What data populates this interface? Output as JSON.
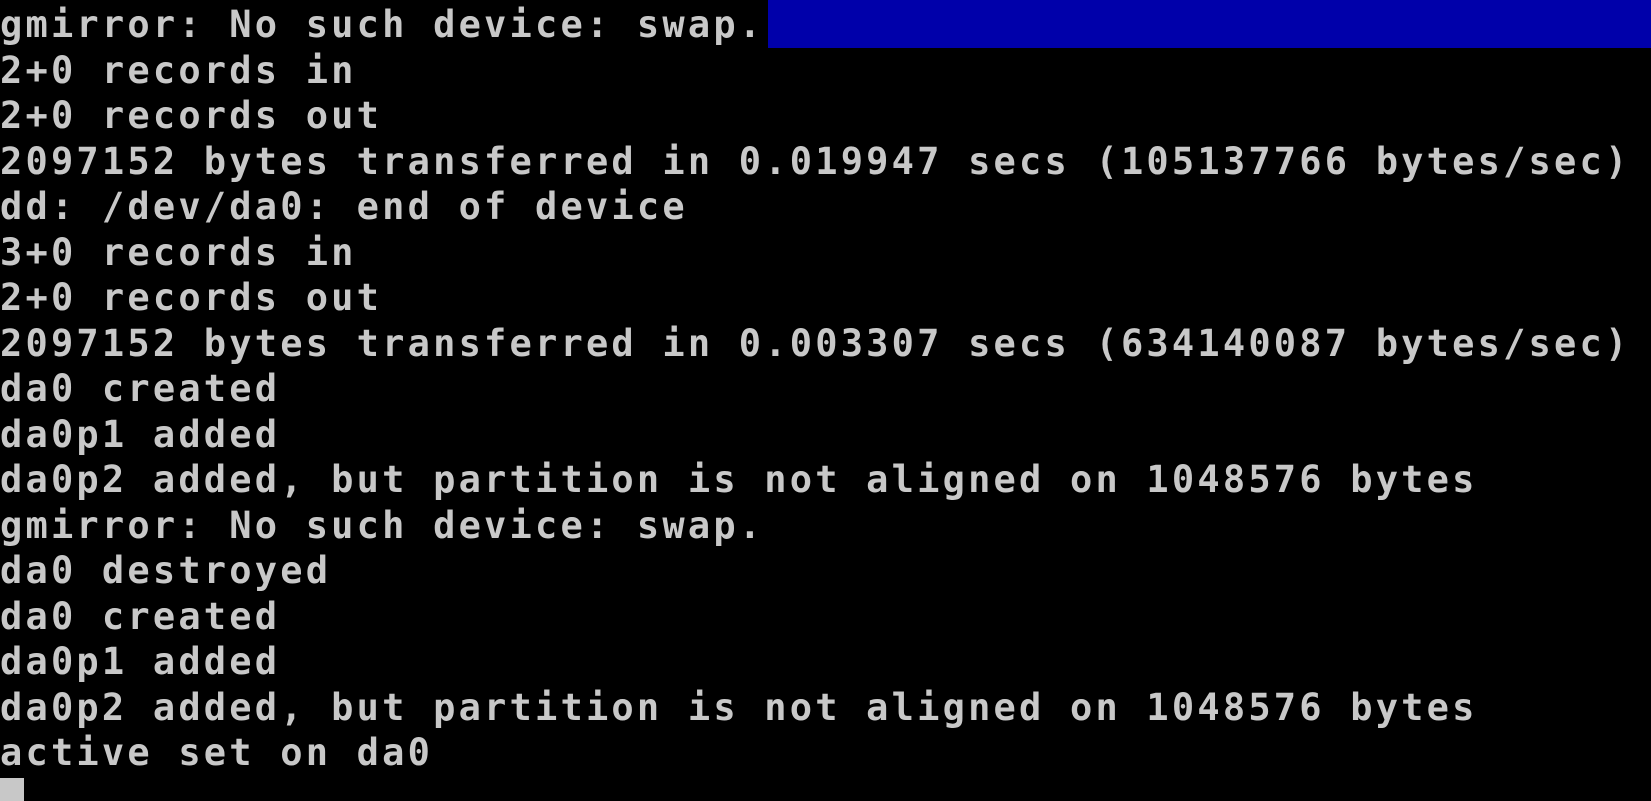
{
  "console": {
    "lines": [
      "gmirror: No such device: swap.",
      "2+0 records in",
      "2+0 records out",
      "2097152 bytes transferred in 0.019947 secs (105137766 bytes/sec)",
      "dd: /dev/da0: end of device",
      "3+0 records in",
      "2+0 records out",
      "2097152 bytes transferred in 0.003307 secs (634140087 bytes/sec)",
      "da0 created",
      "da0p1 added",
      "da0p2 added, but partition is not aligned on 1048576 bytes",
      "gmirror: No such device: swap.",
      "da0 destroyed",
      "da0 created",
      "da0p1 added",
      "da0p2 added, but partition is not aligned on 1048576 bytes",
      "active set on da0"
    ]
  },
  "colors": {
    "background": "#000000",
    "text": "#c8c8c8",
    "status_bar": "#0000aa"
  }
}
